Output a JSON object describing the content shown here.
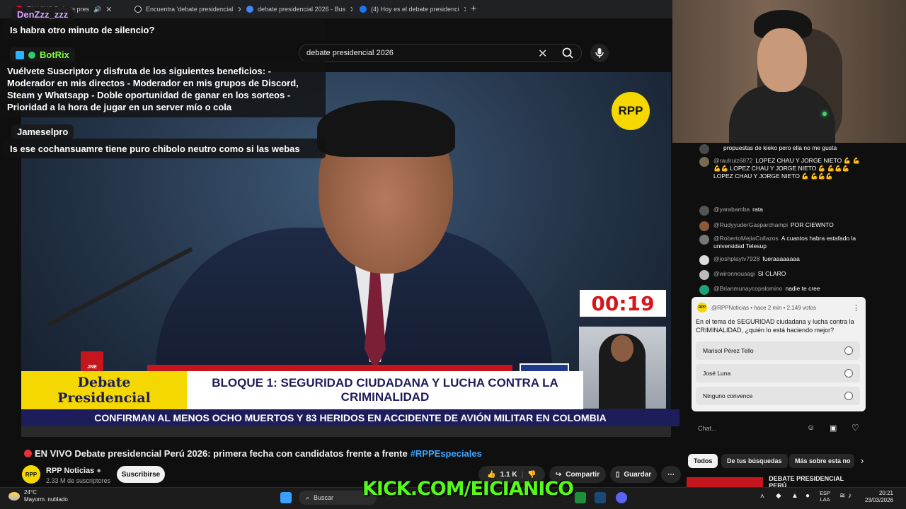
{
  "browser": {
    "tabs": [
      {
        "label": "EN VIVO Debate pres",
        "color": "#ff0033"
      },
      {
        "label": "Encuentra 'debate presidencial",
        "color": "#111111"
      },
      {
        "label": "debate presidencial 2026 - Bus",
        "color": "#4285f4"
      },
      {
        "label": "(4) Hoy es el debate presidenci",
        "color": "#1877f2"
      }
    ]
  },
  "stream_chat": {
    "msg1_user": "DenZzz_zzz",
    "msg1_text": "Is habra otro minuto de silencio?",
    "bot_user": "BotRix",
    "bot_text": "Vuélvete Suscriptor y disfruta de los siguientes beneficios: - Moderador en mis directos - Moderador en mis grupos de Discord, Steam y Whatsapp - Doble oportunidad de ganar en los sorteos - Prioridad a la hora de jugar en un server mío o cola",
    "msg3_user": "Jameselpro",
    "msg3_text": "Is ese cochansuamre tiene puro chibolo neutro como si las webas"
  },
  "search": {
    "value": "debate presidencial 2026"
  },
  "video": {
    "logo": "RPP",
    "timer": "00:19",
    "jne": "JNE",
    "lower_left_line1": "Debate",
    "lower_left_line2": "Presidencial",
    "lower_main": "BLOQUE 1: SEGURIDAD CIUDADANA Y LUCHA CONTRA LA CRIMINALIDAD",
    "ticker": "CONFIRMAN AL MENOS OCHO MUERTOS Y 83 HERIDOS EN ACCIDENTE DE AVIÓN MILITAR EN COLOMBIA"
  },
  "watch": {
    "title": "EN VIVO Debate presidencial Perú 2026: primera fecha con candidatos frente a frente",
    "hashtag": "#RPPEspeciales",
    "channel": "RPP Noticias",
    "subs": "2.33 M de suscriptores",
    "subscribe": "Suscribirse",
    "likes": "1.1 K",
    "share": "Compartir",
    "save": "Guardar",
    "more": "⋯"
  },
  "live_chat": {
    "messages": [
      {
        "author": "",
        "text": "propuestas de kieko pero ella no me gusta"
      },
      {
        "author": "@raulruiz6872",
        "text": "LOPEZ CHAU Y JORGE NIETO 💪 💪💪💪 LOPEZ CHAU Y JORGE NIETO 💪 💪💪💪 LOPEZ CHAU Y JORGE NIETO 💪 💪💪💪"
      },
      {
        "author": "@yarabamba",
        "text": "rata"
      },
      {
        "author": "@RudyyuderGasparchampi",
        "text": "POR CIEWNTO"
      },
      {
        "author": "@RobertoMejiaCollazos",
        "text": "A cuantos habra estafado la universidad Telesup"
      },
      {
        "author": "@joshplaytv7928",
        "text": "fueraaaaaaaa"
      },
      {
        "author": "@wironnousagi",
        "text": "SI CLARO"
      },
      {
        "author": "@Brianmunaycopalomino",
        "text": "nadie te cree"
      }
    ],
    "input_placeholder": "Chat..."
  },
  "poll": {
    "header": "@RPPNoticias • hace 2 min • 2,149 votos",
    "question": "En el tema de SEGURIDAD ciudadana y lucha contra la CRIMINALIDAD, ¿quién lo está haciendo mejor?",
    "options": [
      "Marisol Pérez Tello",
      "José Luna",
      "Ninguno convence"
    ]
  },
  "chips": [
    "Todos",
    "De tus búsquedas",
    "Más sobre esta no"
  ],
  "recommended": {
    "title": "DEBATE PRESIDENCIAL PERÚ"
  },
  "overlay": {
    "kick": "KICK.COM/EICIANICO"
  },
  "taskbar": {
    "temp": "24°C",
    "weather": "Mayorm. nublado",
    "search": "Buscar",
    "lang": "ESP",
    "region": "LAA",
    "time": "20:21",
    "date": "23/03/2026"
  }
}
